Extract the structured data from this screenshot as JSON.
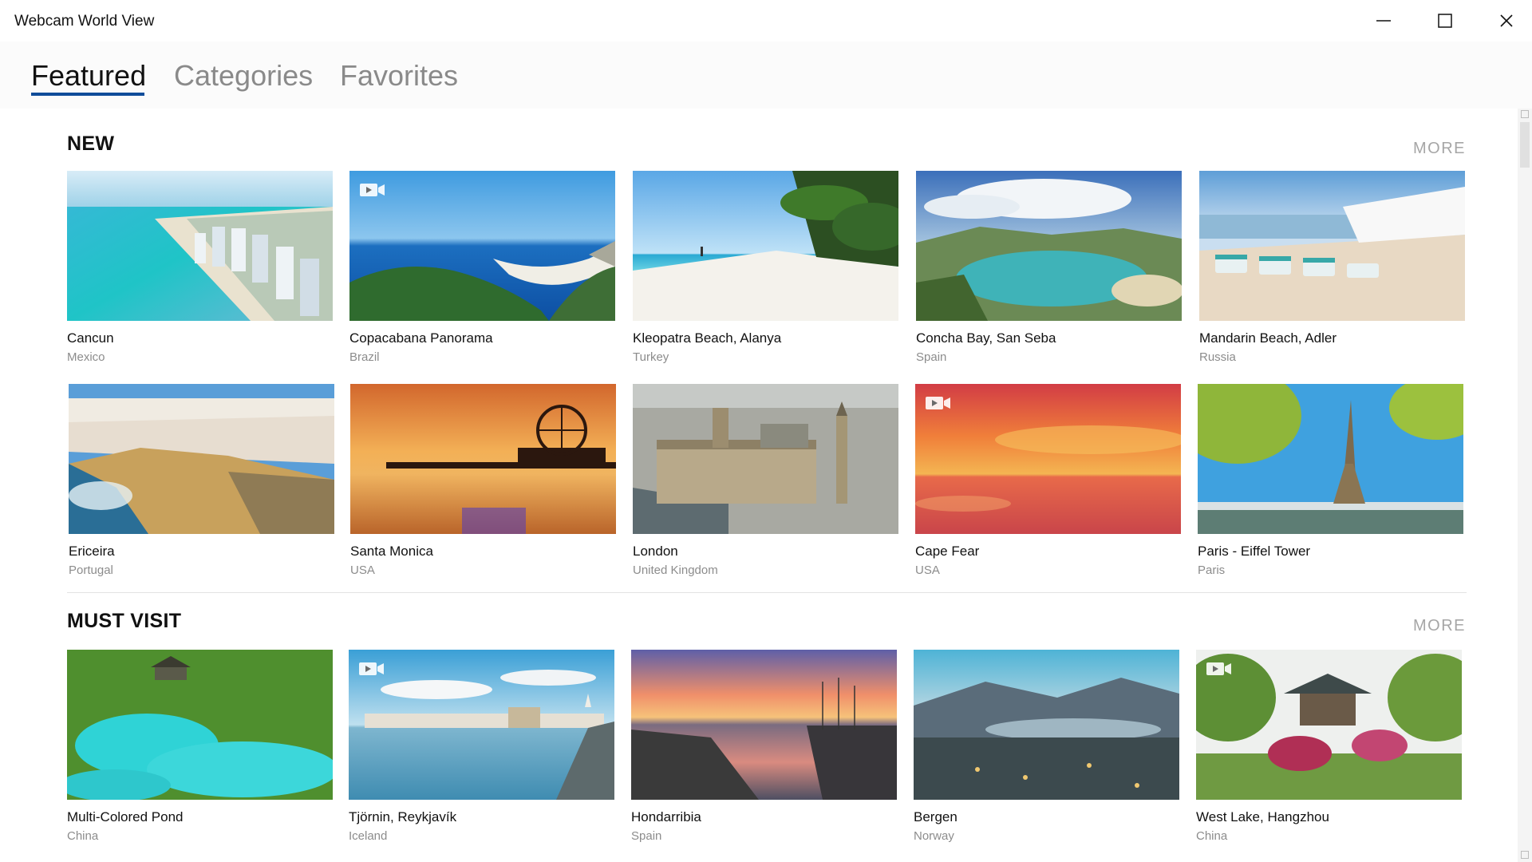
{
  "window": {
    "title": "Webcam World View"
  },
  "tabs": [
    {
      "label": "Featured"
    },
    {
      "label": "Categories"
    },
    {
      "label": "Favorites"
    }
  ],
  "sections": [
    {
      "title": "NEW",
      "more_label": "MORE",
      "items": [
        {
          "name": "Cancun",
          "country": "Mexico",
          "video": false
        },
        {
          "name": "Copacabana Panorama",
          "country": "Brazil",
          "video": true
        },
        {
          "name": "Kleopatra Beach, Alanya",
          "country": "Turkey",
          "video": false
        },
        {
          "name": "Concha Bay, San Seba",
          "country": "Spain",
          "video": false
        },
        {
          "name": "Mandarin Beach, Adler",
          "country": "Russia",
          "video": false
        },
        {
          "name": "Ericeira",
          "country": "Portugal",
          "video": false
        },
        {
          "name": "Santa Monica",
          "country": "USA",
          "video": false
        },
        {
          "name": "London",
          "country": "United Kingdom",
          "video": false
        },
        {
          "name": "Cape Fear",
          "country": "USA",
          "video": true
        },
        {
          "name": "Paris - Eiffel Tower",
          "country": "Paris",
          "video": false
        }
      ]
    },
    {
      "title": "MUST VISIT",
      "more_label": "MORE",
      "items": [
        {
          "name": "Multi-Colored Pond",
          "country": "China",
          "video": false
        },
        {
          "name": "Tjörnin, Reykjavík",
          "country": "Iceland",
          "video": true
        },
        {
          "name": "Hondarribia",
          "country": "Spain",
          "video": false
        },
        {
          "name": "Bergen",
          "country": "Norway",
          "video": false
        },
        {
          "name": "West Lake, Hangzhou",
          "country": "China",
          "video": true
        }
      ]
    }
  ]
}
